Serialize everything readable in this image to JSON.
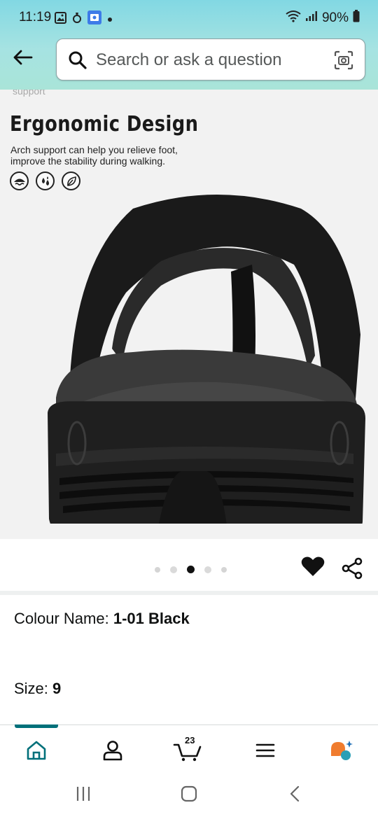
{
  "status_bar": {
    "time": "11:19",
    "battery": "90%"
  },
  "search": {
    "placeholder": "Search or ask a question"
  },
  "product_image": {
    "cut_text": "support",
    "title": "Ergonomic Design",
    "description_line1": "Arch support can help you relieve foot,",
    "description_line2": "improve the stability during walking.",
    "feature_icons": [
      "waterproof-icon",
      "water-drops-icon",
      "leaf-icon"
    ]
  },
  "carousel": {
    "total": 5,
    "active_index": 2
  },
  "variations": {
    "colour_label": "Colour Name:",
    "colour_value": "1-01 Black",
    "size_label": "Size:",
    "size_value": "9"
  },
  "bottom_nav": {
    "items": [
      "home-icon",
      "account-icon",
      "cart-icon",
      "menu-icon",
      "rufus-icon"
    ],
    "cart_count": "23",
    "accent_color": "#00707a"
  },
  "colors": {
    "header_gradient_top": "#82d8e3",
    "header_gradient_bottom": "#a9e4d8",
    "rufus_orange": "#f07c2e",
    "rufus_teal": "#2a9fb5"
  }
}
